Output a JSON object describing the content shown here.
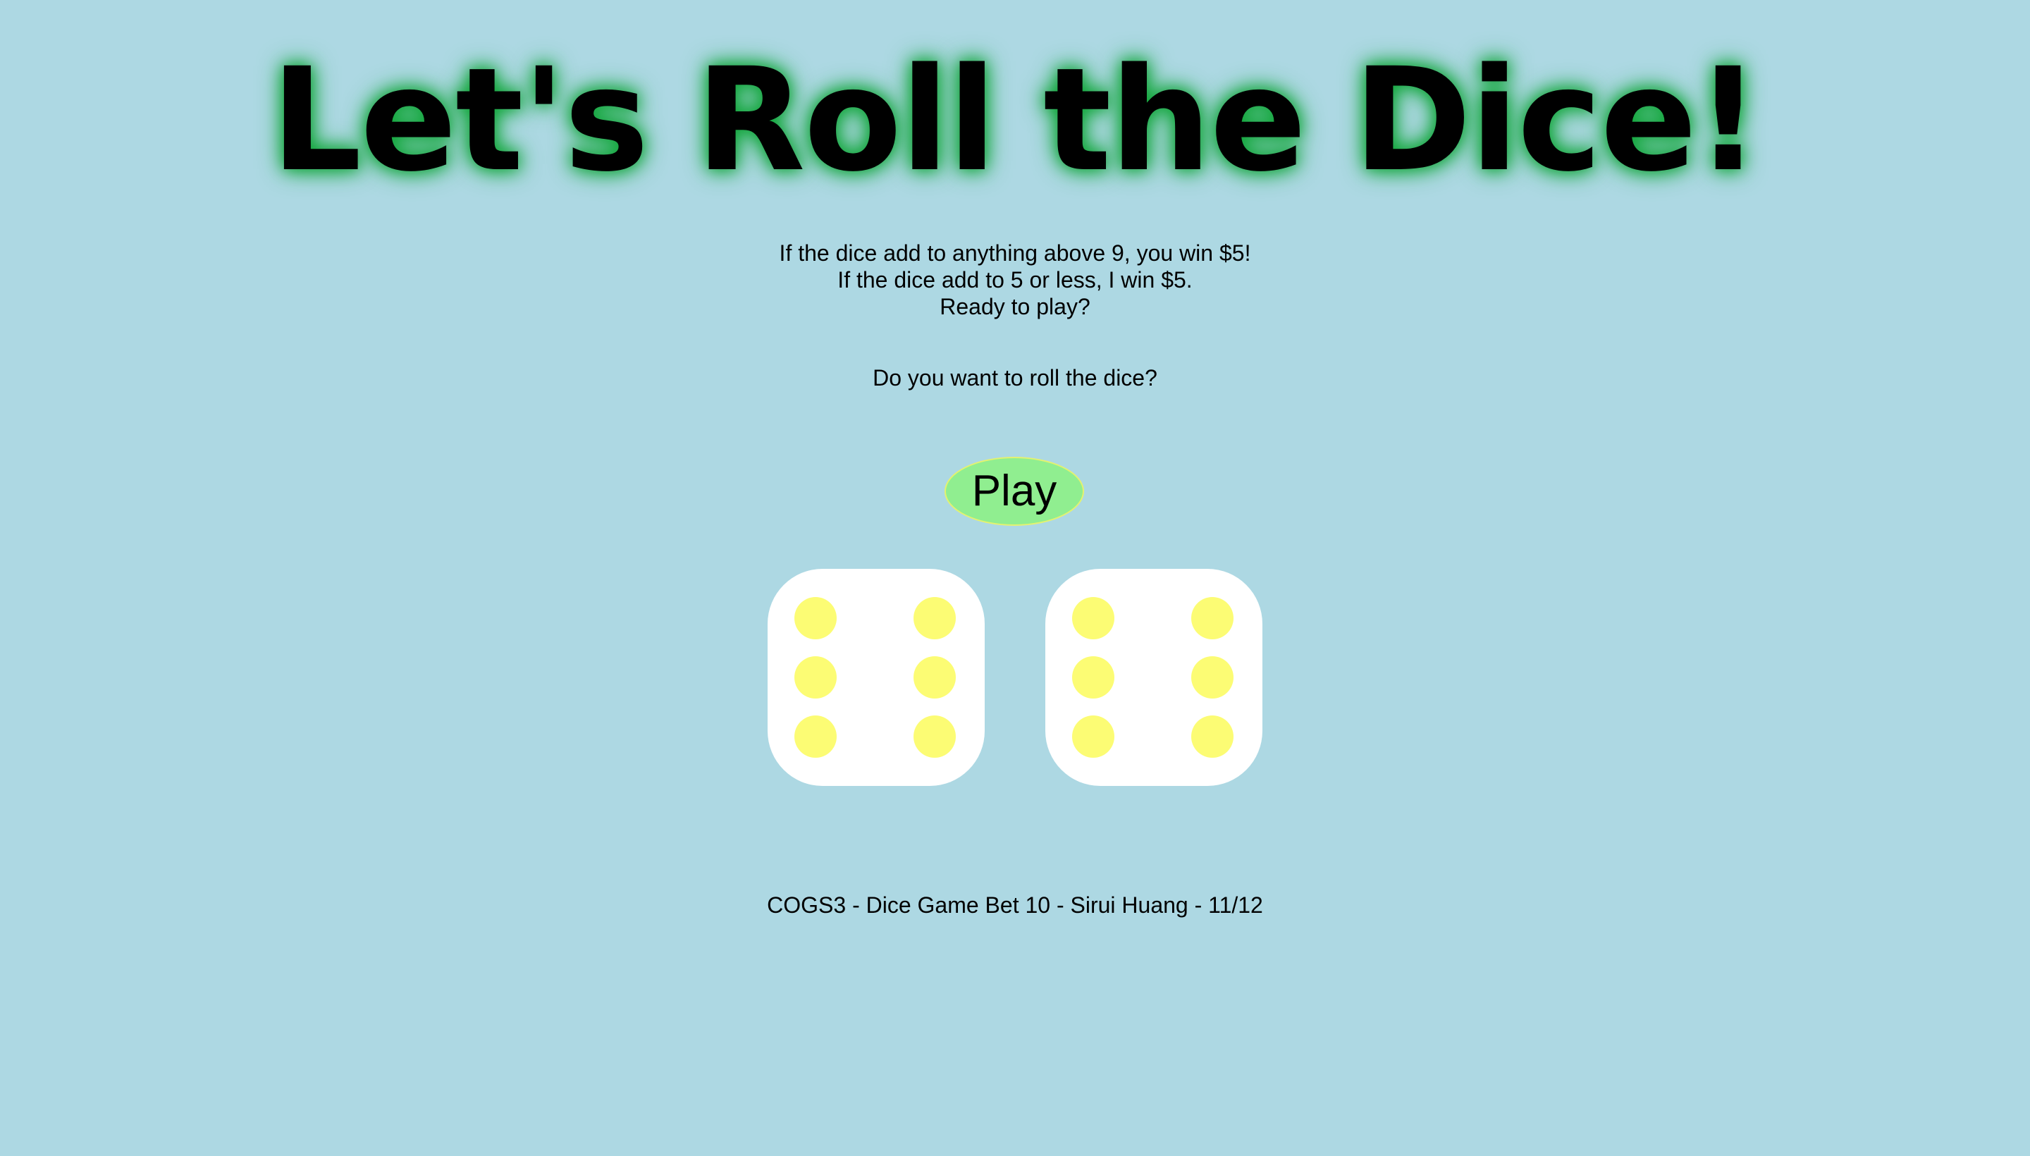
{
  "title": "Let's Roll the Dice!",
  "rules": {
    "line1": "If the dice add to anything above 9, you win $5!",
    "line2": "If the dice add to 5 or less, I win $5.",
    "line3": "Ready to play?"
  },
  "question": "Do you want to roll the dice?",
  "play_button_label": "Play",
  "dice": [
    {
      "value": 6
    },
    {
      "value": 6
    }
  ],
  "footer": "COGS3 - Dice Game Bet 10 - Sirui Huang - 11/12",
  "colors": {
    "background": "#add8e3",
    "title_glow": "#11a63a",
    "play_button": "#90ee90",
    "die_face": "#ffffff",
    "pip": "#fcfc74"
  }
}
